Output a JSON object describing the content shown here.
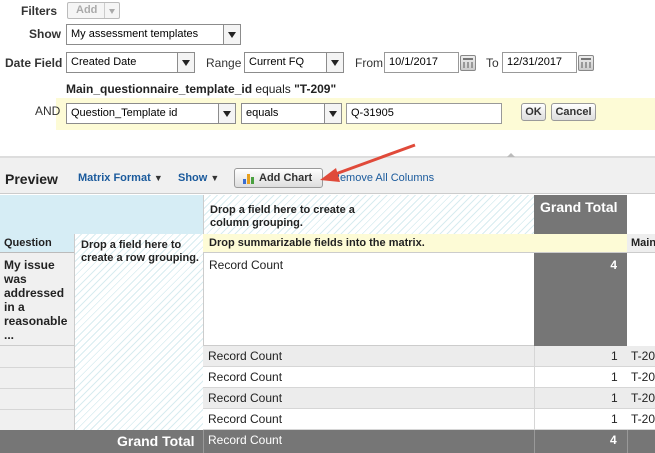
{
  "filters": {
    "filters_label": "Filters",
    "add_label": "Add",
    "show_label": "Show",
    "show_value": "My assessment templates",
    "date_field_label": "Date Field",
    "date_field_value": "Created Date",
    "range_label": "Range",
    "range_value": "Current FQ",
    "from_label": "From",
    "from_value": "10/1/2017",
    "to_label": "To",
    "to_value": "12/31/2017",
    "condition_field": "Main_questionnaire_template_id",
    "condition_op": "equals",
    "condition_value": "\"T-209\"",
    "and_label": "AND",
    "logic_field": "Question_Template id",
    "logic_operator": "equals",
    "logic_value": "Q-31905",
    "ok_label": "OK",
    "cancel_label": "Cancel"
  },
  "preview": {
    "title": "Preview",
    "matrix_format": "Matrix Format",
    "show": "Show",
    "add_chart": "Add Chart",
    "remove_columns": "Remove All Columns"
  },
  "matrix": {
    "drop_column": "Drop a field here to create a column grouping.",
    "grand_total_header": "Grand Total",
    "question_header": "Question",
    "drop_row": "Drop a field here to create a row grouping.",
    "drop_summarizable": "Drop summarizable fields into the matrix.",
    "main_header_partial": "Main",
    "question_value": "My issue was addressed in a reasonable ...",
    "first_record_label": "Record Count",
    "first_record_total": "4",
    "rows": [
      {
        "label": "Record Count",
        "value": "1",
        "partial": "T-20"
      },
      {
        "label": "Record Count",
        "value": "1",
        "partial": "T-20"
      },
      {
        "label": "Record Count",
        "value": "1",
        "partial": "T-20"
      },
      {
        "label": "Record Count",
        "value": "1",
        "partial": "T-20"
      }
    ],
    "grand_total_label": "Grand Total",
    "grand_total_record": "Record Count",
    "grand_total_value": "4"
  }
}
